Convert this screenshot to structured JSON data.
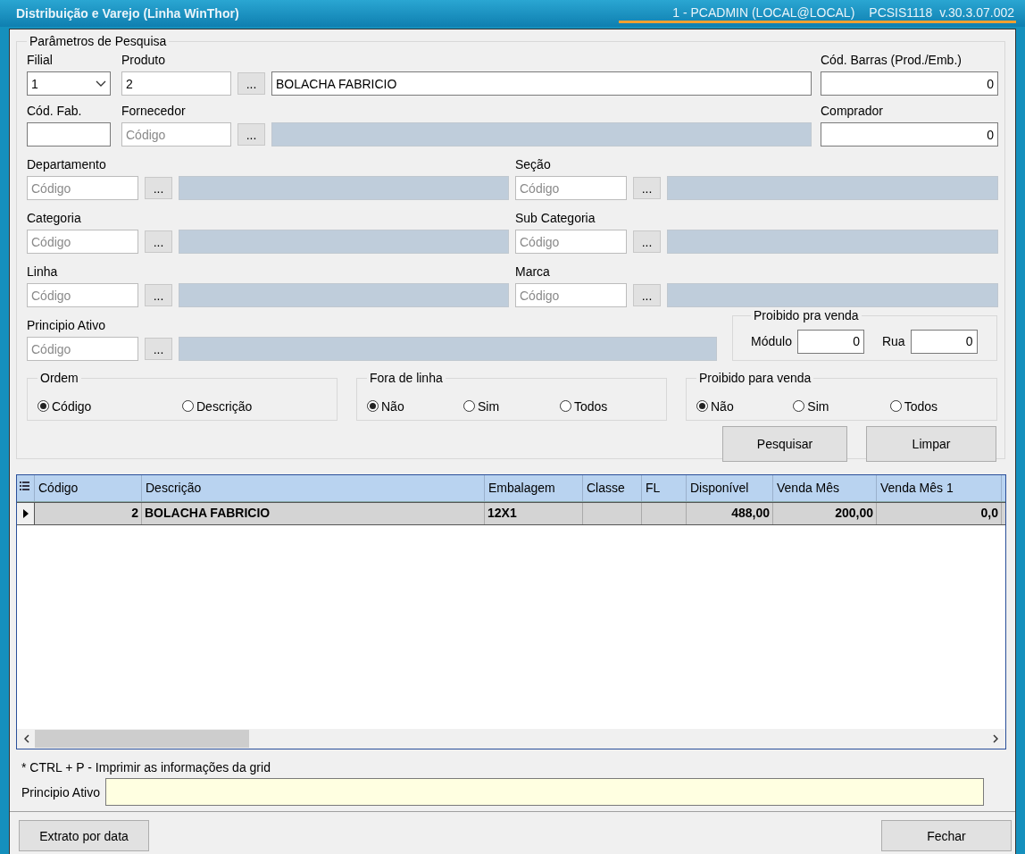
{
  "window": {
    "title": "Distribuição e Varejo (Linha WinThor)",
    "user": "1 - PCADMIN (LOCAL@LOCAL)",
    "version": "PCSIS1118  v.30.3.07.002"
  },
  "search": {
    "title": "Parâmetros de Pesquisa",
    "filial": {
      "label": "Filial",
      "value": "1"
    },
    "produto": {
      "label": "Produto",
      "code": "2",
      "button": "...",
      "description": "BOLACHA FABRICIO"
    },
    "cod_barras": {
      "label": "Cód. Barras (Prod./Emb.)",
      "value": "0"
    },
    "cod_fab": {
      "label": "Cód. Fab."
    },
    "fornecedor": {
      "label": "Fornecedor",
      "placeholder": "Código",
      "button": "..."
    },
    "comprador": {
      "label": "Comprador",
      "value": "0"
    },
    "lookups": [
      {
        "label": "Departamento",
        "placeholder": "Código",
        "button": "..."
      },
      {
        "label": "Seção",
        "placeholder": "Código",
        "button": "..."
      },
      {
        "label": "Categoria",
        "placeholder": "Código",
        "button": "..."
      },
      {
        "label": "Sub Categoria",
        "placeholder": "Código",
        "button": "..."
      },
      {
        "label": "Linha",
        "placeholder": "Código",
        "button": "..."
      },
      {
        "label": "Marca",
        "placeholder": "Código",
        "button": "..."
      }
    ],
    "principio_ativo": {
      "label": "Principio Ativo",
      "placeholder": "Código",
      "button": "..."
    },
    "proibido": {
      "title": "Proibido pra venda",
      "modulo_label": "Módulo",
      "modulo": "0",
      "rua_label": "Rua",
      "rua": "0"
    },
    "radio_groups": [
      {
        "title": "Ordem",
        "options": [
          {
            "label": "Código",
            "selected": true
          },
          {
            "label": "Descrição",
            "selected": false
          }
        ]
      },
      {
        "title": "Fora de linha",
        "options": [
          {
            "label": "Não",
            "selected": true
          },
          {
            "label": "Sim",
            "selected": false
          },
          {
            "label": "Todos",
            "selected": false
          }
        ]
      },
      {
        "title": "Proibido para venda",
        "options": [
          {
            "label": "Não",
            "selected": true
          },
          {
            "label": "Sim",
            "selected": false
          },
          {
            "label": "Todos",
            "selected": false
          }
        ]
      }
    ],
    "buttons": [
      "Pesquisar",
      "Limpar"
    ]
  },
  "grid": {
    "columns": [
      {
        "label": "Código",
        "kind": "number"
      },
      {
        "label": "Descrição",
        "kind": "text"
      },
      {
        "label": "Embalagem",
        "kind": "text"
      },
      {
        "label": "Classe",
        "kind": "text"
      },
      {
        "label": "FL",
        "kind": "text"
      },
      {
        "label": "Disponível",
        "kind": "number"
      },
      {
        "label": "Venda Mês",
        "kind": "number"
      },
      {
        "label": "Venda Mês 1",
        "kind": "number"
      }
    ],
    "rows": [
      {
        "selected": true,
        "cells": [
          "2",
          "BOLACHA FABRICIO",
          "12X1",
          null,
          null,
          "488,00",
          "200,00",
          "0,0"
        ]
      }
    ]
  },
  "hint": "* CTRL + P - Imprimir as informações da grid",
  "principio_field": {
    "label": "Principio Ativo"
  },
  "footer_buttons": [
    "Extrato por data",
    "Fechar"
  ]
}
